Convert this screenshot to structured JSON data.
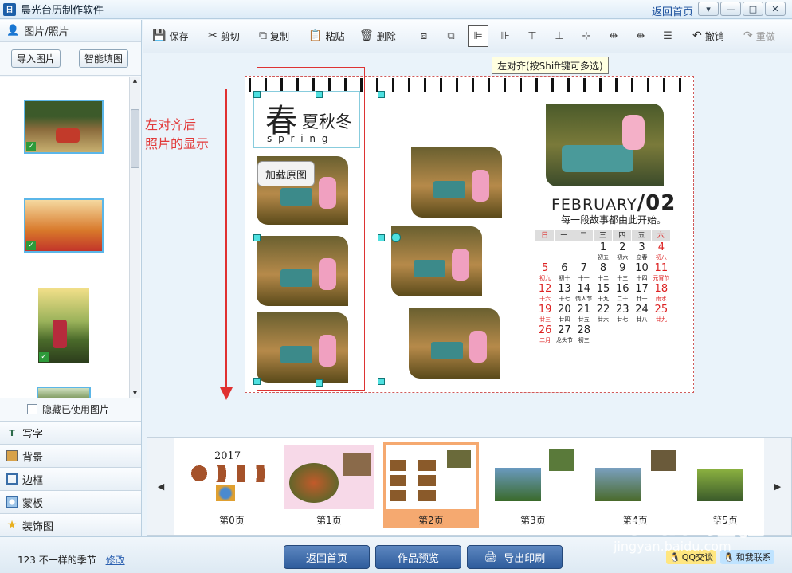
{
  "app": {
    "title": "晨光台历制作软件",
    "back_home": "返回首页"
  },
  "sidebar": {
    "header": "图片/照片",
    "import_btn": "导入图片",
    "smart_fill_btn": "智能填图",
    "hide_used": "隐藏已使用图片",
    "items": [
      {
        "label": "写字",
        "icon": "text-icon"
      },
      {
        "label": "背景",
        "icon": "background-icon"
      },
      {
        "label": "边框",
        "icon": "frame-icon"
      },
      {
        "label": "蒙板",
        "icon": "mask-icon"
      },
      {
        "label": "装饰图",
        "icon": "star-icon"
      }
    ]
  },
  "toolbar": {
    "save": "保存",
    "cut": "剪切",
    "copy": "复制",
    "paste": "粘贴",
    "delete": "删除",
    "undo": "撤销",
    "redo": "重做",
    "tooltip": "左对齐(按Shift键可多选)"
  },
  "canvas": {
    "annotation": [
      "左对齐后",
      "照片的显示"
    ],
    "season_big": "春",
    "season_rest": "夏秋冬",
    "season_en": "s p r i n g",
    "load_original": "加载原图",
    "month": "FEBRUARY",
    "month_num": "/02",
    "story": "每一段故事都由此开始。",
    "weekdays": [
      "日",
      "一",
      "二",
      "三",
      "四",
      "五",
      "六"
    ],
    "weeks": [
      {
        "days": [
          "",
          "",
          "",
          "1",
          "2",
          "3",
          "4"
        ],
        "lunar": [
          "",
          "",
          "",
          "初五",
          "初六",
          "立春",
          "初八"
        ]
      },
      {
        "days": [
          "5",
          "6",
          "7",
          "8",
          "9",
          "10",
          "11"
        ],
        "lunar": [
          "初九",
          "初十",
          "十一",
          "十二",
          "十三",
          "十四",
          "元宵节"
        ]
      },
      {
        "days": [
          "12",
          "13",
          "14",
          "15",
          "16",
          "17",
          "18"
        ],
        "lunar": [
          "十六",
          "十七",
          "情人节",
          "十九",
          "二十",
          "廿一",
          "雨水"
        ]
      },
      {
        "days": [
          "19",
          "20",
          "21",
          "22",
          "23",
          "24",
          "25"
        ],
        "lunar": [
          "廿三",
          "廿四",
          "廿五",
          "廿六",
          "廿七",
          "廿八",
          "廿九"
        ]
      },
      {
        "days": [
          "26",
          "27",
          "28",
          "",
          "",
          "",
          ""
        ],
        "lunar": [
          "二月",
          "龙头节",
          "初三",
          "",
          "",
          "",
          ""
        ]
      }
    ]
  },
  "pages": [
    {
      "label": "第0页",
      "year": "2017"
    },
    {
      "label": "第1页"
    },
    {
      "label": "第2页"
    },
    {
      "label": "第3页"
    },
    {
      "label": "第4页"
    },
    {
      "label": "第5页"
    }
  ],
  "bottom": {
    "status": "123 不一样的季节",
    "edit": "修改",
    "back_home": "返回首页",
    "preview": "作品预览",
    "export_print": "导出印刷",
    "qq": "QQ交谈",
    "contact": "和我联系"
  },
  "watermark": {
    "text": "Baidu 经验",
    "url": "jingyan.baidu.com"
  },
  "colors": {
    "accent": "#5bb6e8",
    "active_page": "#f5a970",
    "annotation": "#e23a3a",
    "handle": "#4fe0e0"
  }
}
